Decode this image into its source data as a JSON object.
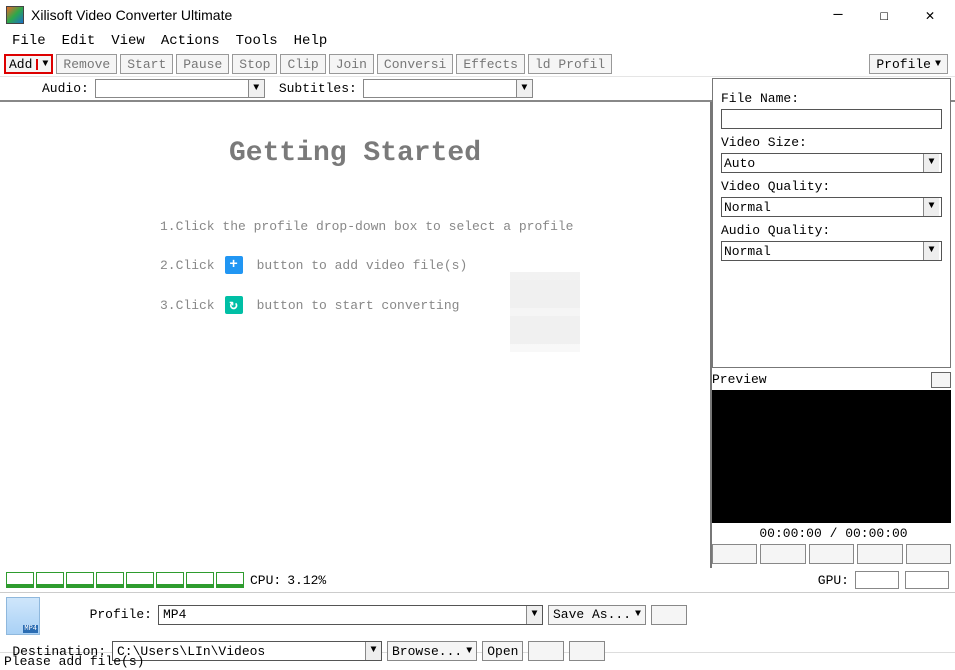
{
  "window": {
    "title": "Xilisoft Video Converter Ultimate"
  },
  "menubar": [
    "File",
    "Edit",
    "View",
    "Actions",
    "Tools",
    "Help"
  ],
  "toolbar": {
    "add": "Add",
    "buttons": [
      "Remove",
      "Start",
      "Pause",
      "Stop",
      "Clip",
      "Join",
      "Conversi",
      "Effects",
      "ld Profil"
    ],
    "profile": "Profile"
  },
  "subbar": {
    "audio_label": "Audio:",
    "subtitles_label": "Subtitles:"
  },
  "getting_started": {
    "title": "Getting Started",
    "step1": "1.Click the profile drop-down box to select a profile",
    "step2_before": "2.Click",
    "step2_after": "button to add video file(s)",
    "step3_before": "3.Click",
    "step3_after": "button to start converting"
  },
  "right_panel": {
    "file_name_label": "File Name:",
    "file_name_value": "",
    "video_size_label": "Video Size:",
    "video_size_value": "Auto",
    "video_quality_label": "Video Quality:",
    "video_quality_value": "Normal",
    "audio_quality_label": "Audio Quality:",
    "audio_quality_value": "Normal",
    "preview_label": "Preview",
    "time": "00:00:00 / 00:00:00"
  },
  "cpu": {
    "label": "CPU:",
    "value": "3.12%",
    "gpu_label": "GPU:"
  },
  "bottom": {
    "profile_label": "Profile:",
    "profile_value": "MP4",
    "saveas": "Save As...",
    "destination_label": "Destination:",
    "destination_value": "C:\\Users\\LIn\\Videos",
    "browse": "Browse...",
    "open": "Open"
  },
  "status": "Please add file(s)"
}
